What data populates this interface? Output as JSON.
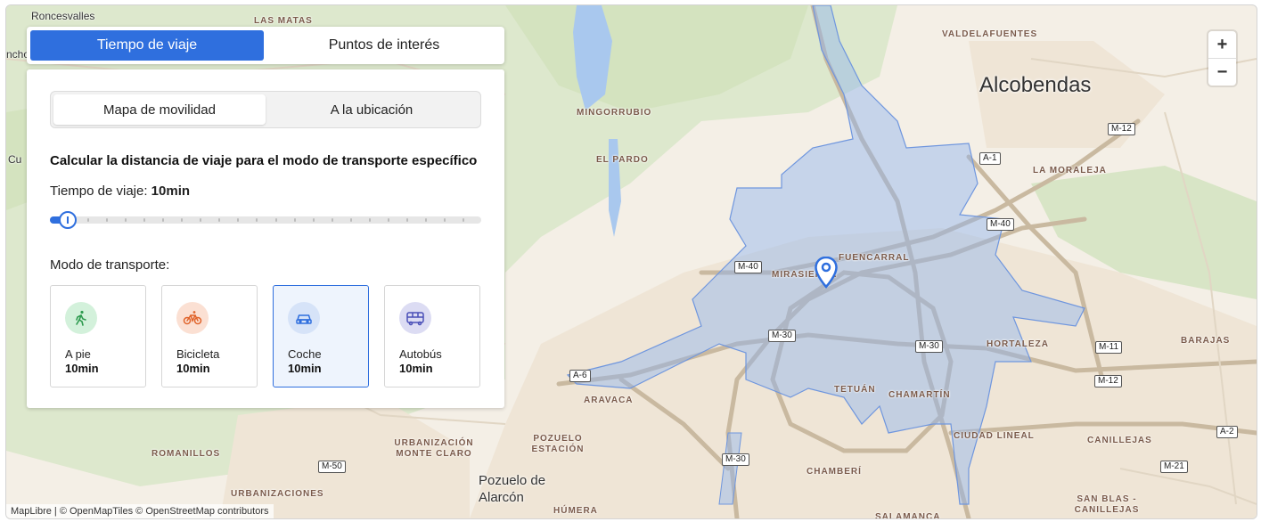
{
  "tabs": [
    {
      "label": "Tiempo de viaje",
      "active": true
    },
    {
      "label": "Puntos de interés",
      "active": false
    }
  ],
  "segmented": [
    {
      "label": "Mapa de movilidad",
      "active": true
    },
    {
      "label": "A la ubicación",
      "active": false
    }
  ],
  "panel": {
    "heading": "Calcular la distancia de viaje para el modo de transporte específico",
    "time_label": "Tiempo de viaje:",
    "time_value": "10min",
    "slider": {
      "fraction": 0.04,
      "ticks": 23
    },
    "mode_label": "Modo de transporte:"
  },
  "modes": [
    {
      "name": "A pie",
      "time": "10min",
      "icon": "walk-icon",
      "color": "#2e9b4f",
      "bg": "#d3f1db",
      "selected": false
    },
    {
      "name": "Bicicleta",
      "time": "10min",
      "icon": "bicycle-icon",
      "color": "#e0632a",
      "bg": "#fbe0d3",
      "selected": false
    },
    {
      "name": "Coche",
      "time": "10min",
      "icon": "car-icon",
      "color": "#2f6fde",
      "bg": "#d6e3f8",
      "selected": true
    },
    {
      "name": "Autobús",
      "time": "10min",
      "icon": "bus-icon",
      "color": "#4a4fb8",
      "bg": "#dcdcf3",
      "selected": false
    }
  ],
  "zoom": {
    "in": "+",
    "out": "−"
  },
  "attribution": {
    "brand": "MapLibre",
    "text": " | © OpenMapTiles © OpenStreetMap contributors"
  },
  "map": {
    "places": [
      "Roncesvalles",
      "LAS MATAS",
      "VALDELAFUENTES",
      "MINGORRUBIO",
      "EL PARDO",
      "LA MORALEJA",
      "FUENCARRAL",
      "MIRASIERRA",
      "HORTALEZA",
      "BARAJAS",
      "TETUÁN",
      "CHAMARTÍN",
      "ARAVACA",
      "POZUELO ESTACIÓN",
      "URBANIZACIÓN MONTE CLARO",
      "ROMANILLOS",
      "CIUDAD LINEAL",
      "CANILLEJAS",
      "CHAMBERÍ",
      "HÚMERA",
      "SAN BLAS - CANILLEJAS",
      "URBANIZACIONES",
      "SALAMANCA",
      "Cu",
      "ncho"
    ],
    "cities": [
      "Alcobendas",
      "Pozuelo de Alarcón"
    ],
    "shields": [
      "M-12",
      "A-1",
      "M-40",
      "M-40",
      "M-30",
      "M-30",
      "M-11",
      "M-12",
      "A-6",
      "M-50",
      "M-30",
      "A-2",
      "M-21"
    ],
    "colors": {
      "isochrone": "#8fb3ef",
      "road": "#c9b9a0",
      "urban": "#ede4d8",
      "green": "#dfe9cf",
      "water": "#a9c8ee"
    }
  }
}
